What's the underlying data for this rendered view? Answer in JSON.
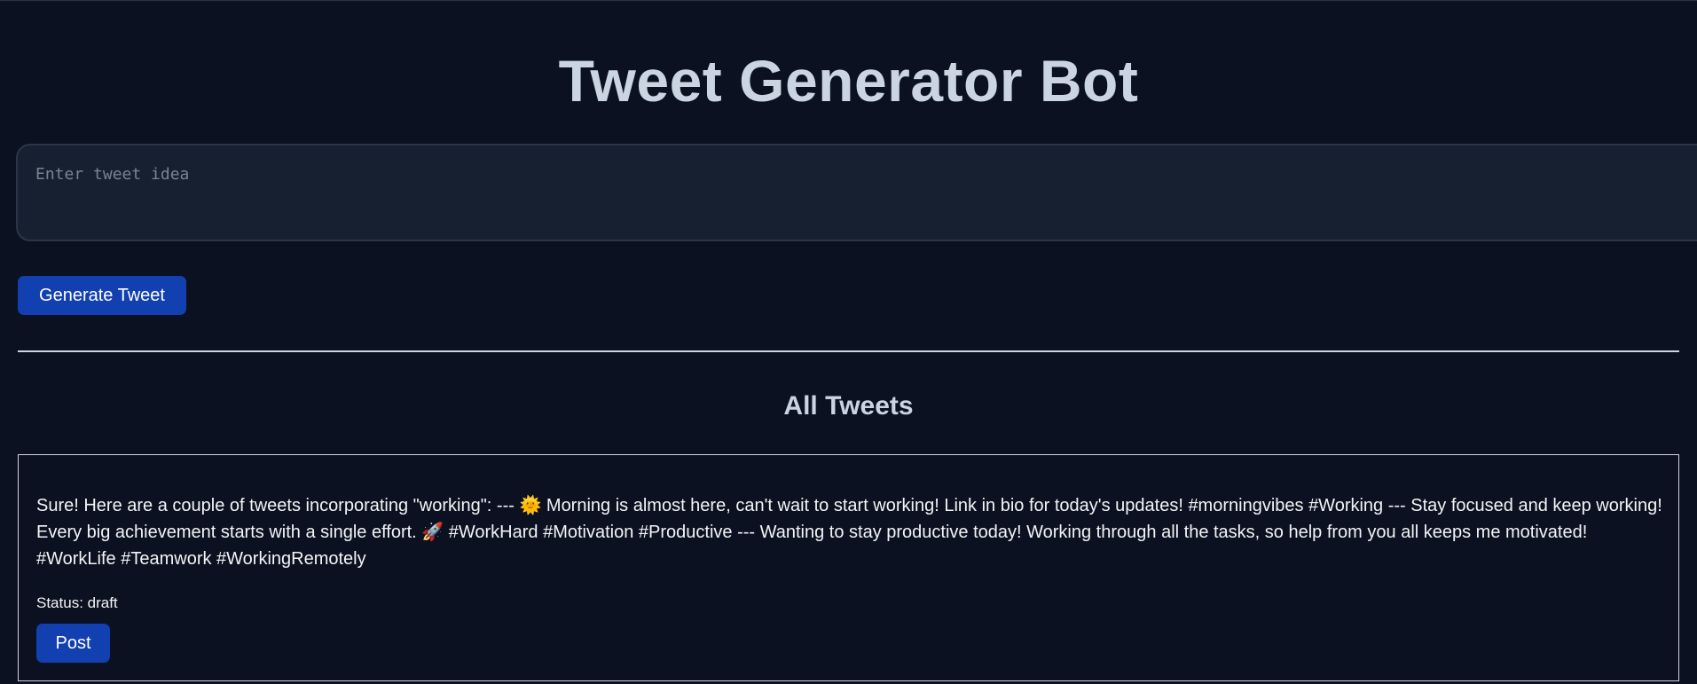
{
  "app": {
    "title": "Tweet Generator Bot"
  },
  "composer": {
    "input_value": "",
    "input_placeholder": "Enter tweet idea",
    "generate_label": "Generate Tweet"
  },
  "tweets_section": {
    "heading": "All Tweets",
    "tweets": [
      {
        "text": "Sure! Here are a couple of tweets incorporating \"working\": --- 🌞 Morning is almost here, can't wait to start working! Link in bio for today's updates! #morningvibes #Working --- Stay focused and keep working! Every big achievement starts with a single effort. 🚀 #WorkHard #Motivation #Productive --- Wanting to stay productive today! Working through all the tasks, so help from you all keeps me motivated! #WorkLife #Teamwork #WorkingRemotely",
        "status": "Status: draft",
        "post_label": "Post"
      }
    ]
  },
  "colors": {
    "background": "#0b1120",
    "accent_button": "#1240b0",
    "heading_text": "#cbd5e1",
    "input_background": "#172030"
  }
}
